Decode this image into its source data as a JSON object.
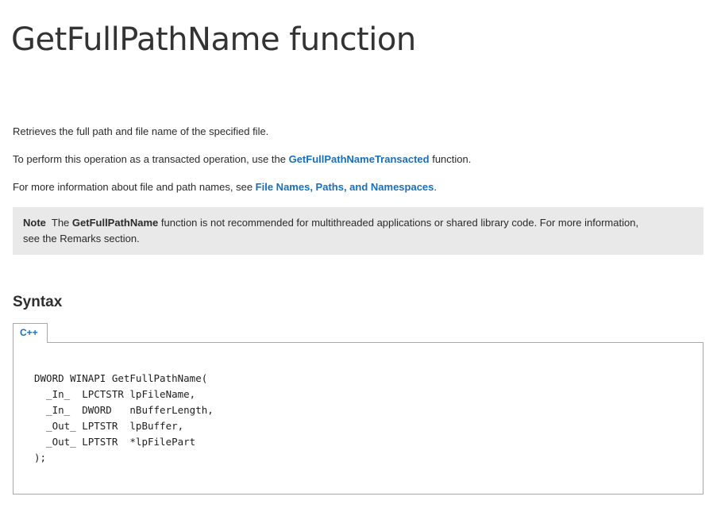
{
  "page": {
    "title": "GetFullPathName function"
  },
  "intro": {
    "p1": "Retrieves the full path and file name of the specified file.",
    "p2_before": "To perform this operation as a transacted operation, use the ",
    "p2_link": "GetFullPathNameTransacted",
    "p2_after": " function.",
    "p3_before": "For more information about file and path names, see ",
    "p3_link": "File Names, Paths, and Namespaces",
    "p3_after": "."
  },
  "note": {
    "label": "Note",
    "pre": "The ",
    "func": "GetFullPathName",
    "text1": " function is not recommended for multithreaded applications or shared library code. For more information,",
    "text2": "see the Remarks section."
  },
  "syntax": {
    "heading": "Syntax",
    "tab_label": "C++",
    "code": "DWORD WINAPI GetFullPathName(\n  _In_  LPCTSTR lpFileName,\n  _In_  DWORD   nBufferLength,\n  _Out_ LPTSTR  lpBuffer,\n  _Out_ LPTSTR  *lpFilePart\n);"
  },
  "colors": {
    "link": "#1a6fb5",
    "note_background": "#e9e9ea",
    "code_border": "#a8a8a8"
  }
}
